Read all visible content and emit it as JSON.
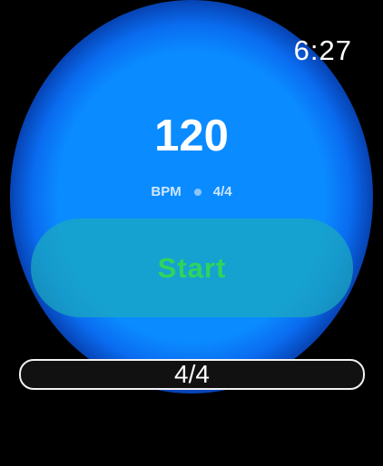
{
  "status": {
    "time": "6:27"
  },
  "metronome": {
    "bpm_value": "120",
    "bpm_unit": "BPM",
    "time_signature": "4/4",
    "start_label": "Start"
  },
  "picker": {
    "value": "4/4"
  },
  "colors": {
    "glow": "#0a8bff",
    "start_text": "#2fd45c",
    "start_bg": "#1caabe",
    "background": "#000000"
  }
}
